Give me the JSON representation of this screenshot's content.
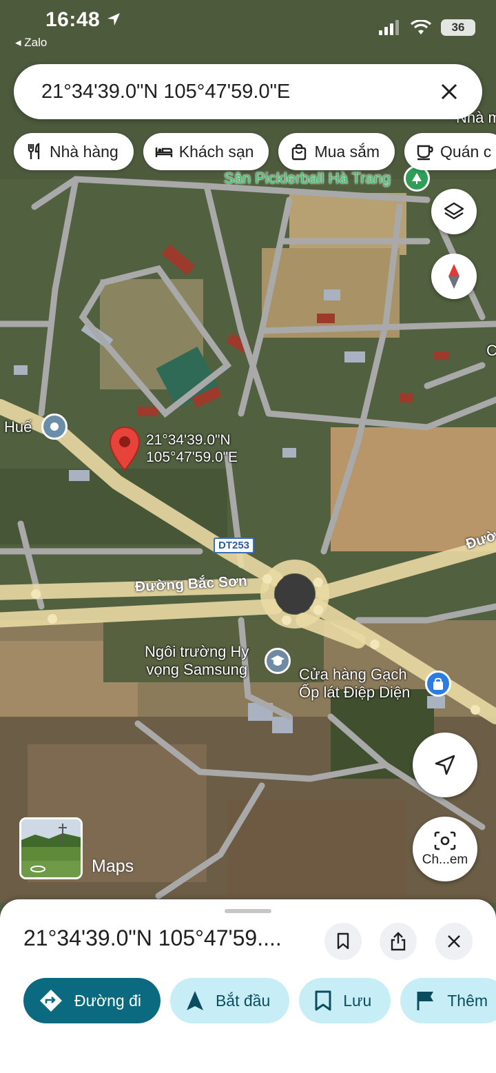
{
  "status_bar": {
    "time": "16:48",
    "back_app": "◂ Zalo",
    "battery": "36"
  },
  "search": {
    "query": "21°34'39.0\"N 105°47'59.0\"E"
  },
  "chips": [
    {
      "label": "Nhà hàng",
      "icon": "restaurant-icon"
    },
    {
      "label": "Khách sạn",
      "icon": "hotel-icon"
    },
    {
      "label": "Mua sắm",
      "icon": "shopping-icon"
    },
    {
      "label": "Quán c",
      "icon": "coffee-icon"
    }
  ],
  "map": {
    "labels": {
      "pickleball": "Sân Picklerball Hà Trang",
      "hue": "Huế",
      "pin_line1": "21°34'39.0\"N",
      "pin_line2": "105°47'59.0\"E",
      "route": "DT253",
      "road_bac_son": "Đường Bắc Sơn",
      "road_right": "Đườ",
      "school_line1": "Ngôi trường Hy",
      "school_line2": "vọng Samsung",
      "shop_line1": "Cửa hàng Gạch",
      "shop_line2": "Ốp lát Điệp Diện",
      "top_right_partial": "Nhà m",
      "right_edge_partial": "C"
    },
    "lens_label": "Ch...em",
    "watermark": "Maps"
  },
  "sheet": {
    "title": "21°34'39.0\"N 105°47'59....",
    "actions": [
      {
        "label": "Đường đi",
        "icon": "directions-icon"
      },
      {
        "label": "Bắt đầu",
        "icon": "navigation-icon"
      },
      {
        "label": "Lưu",
        "icon": "bookmark-icon"
      },
      {
        "label": "Thêm",
        "icon": "flag-icon"
      }
    ]
  }
}
